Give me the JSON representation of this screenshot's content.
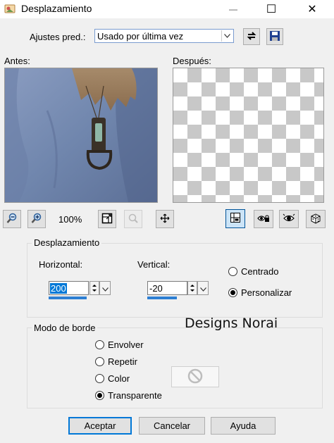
{
  "window": {
    "title": "Desplazamiento",
    "minimize_glyph": "—",
    "maximize_glyph": "☐",
    "close_glyph": "✕"
  },
  "presets": {
    "label": "Ajustes pred.:",
    "selected": "Usado por última vez"
  },
  "preview": {
    "before_label": "Antes:",
    "after_label": "Después:",
    "zoom": "100%"
  },
  "offset": {
    "group_title": "Desplazamiento",
    "horizontal_label": "Horizontal:",
    "horizontal_value": "200",
    "vertical_label": "Vertical:",
    "vertical_value": "-20",
    "center_label": "Centrado",
    "custom_label": "Personalizar",
    "selected": "Personalizar"
  },
  "edge_mode": {
    "group_title": "Modo de borde",
    "options": [
      "Envolver",
      "Repetir",
      "Color",
      "Transparente"
    ],
    "selected": "Transparente"
  },
  "watermark": "Designs Norai",
  "buttons": {
    "ok": "Aceptar",
    "cancel": "Cancelar",
    "help": "Ayuda"
  },
  "colors": {
    "accent": "#0078d7",
    "spin_bar": "#2d7fd3",
    "dialog_bg": "#f0f0f0"
  }
}
